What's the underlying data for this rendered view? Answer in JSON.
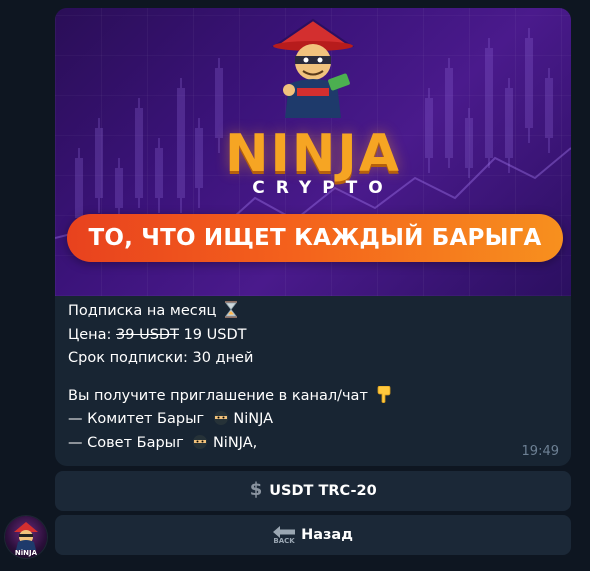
{
  "banner": {
    "brand": "NINJA",
    "brand_sub": "CRYPTO",
    "ribbon": "ТО, ЧТО ИЩЕТ КАЖДЫЙ БАРЫГА",
    "colors": {
      "bg": "#3b137a",
      "brand": "#f6a523",
      "ribbon": "#f4611c"
    },
    "mascot_icon": "ninja-mascot-icon"
  },
  "message": {
    "title": "Подписка на месяц",
    "title_icon": "hourglass-icon",
    "price_label": "Цена:",
    "old_price": "39 USDT",
    "new_price": "19 USDT",
    "term": "Срок подписки: 30 дней",
    "invite": "Вы получите приглашение в канал/чат",
    "invite_icon": "pointing-down-icon",
    "items": [
      {
        "text": "— Комитет Барыг",
        "suffix": "NiNJA",
        "icon": "ninja-icon"
      },
      {
        "text": "— Совет Барыг",
        "suffix": "NiNJA,",
        "icon": "ninja-icon"
      }
    ],
    "time": "19:49"
  },
  "buttons": {
    "usdt_label": "USDT TRC-20",
    "usdt_icon": "dollar-icon",
    "back_label": "Назад",
    "back_icon": "back-arrow-icon",
    "back_icon_text": "BACK"
  },
  "avatar": {
    "label": "NiNJA"
  }
}
